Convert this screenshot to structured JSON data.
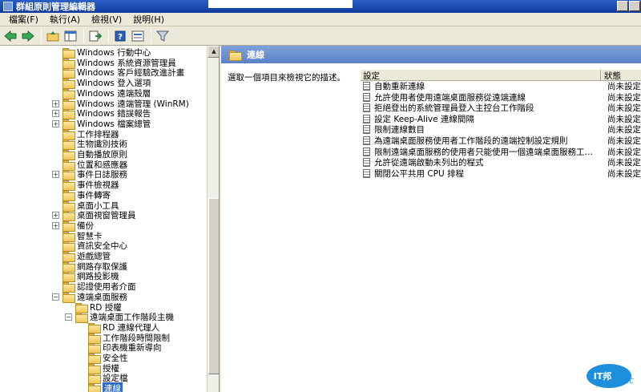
{
  "window": {
    "title": "群組原則管理編輯器"
  },
  "menu": [
    "檔案(F)",
    "執行(A)",
    "檢視(V)",
    "說明(H)"
  ],
  "toolbar": [
    "back-icon",
    "forward-icon",
    "up-folder-icon",
    "show-hide-tree-icon",
    "export-list-icon",
    "help-icon",
    "properties-icon",
    "filter-icon"
  ],
  "tree": [
    {
      "label": "Windows 行動中心",
      "indent": 0,
      "expandable": false
    },
    {
      "label": "Windows 系統資源管理員",
      "indent": 0,
      "expandable": false
    },
    {
      "label": "Windows 客戶經驗改進計畫",
      "indent": 0,
      "expandable": false
    },
    {
      "label": "Windows 登入選項",
      "indent": 0,
      "expandable": false
    },
    {
      "label": "Windows 遠端殼層",
      "indent": 0,
      "expandable": false
    },
    {
      "label": "Windows 遠端管理 (WinRM)",
      "indent": 0,
      "expandable": true
    },
    {
      "label": "Windows 錯誤報告",
      "indent": 0,
      "expandable": true
    },
    {
      "label": "Windows 檔案總管",
      "indent": 0,
      "expandable": true
    },
    {
      "label": "工作排程器",
      "indent": 0,
      "expandable": false
    },
    {
      "label": "生物識別技術",
      "indent": 0,
      "expandable": false
    },
    {
      "label": "自動播放原則",
      "indent": 0,
      "expandable": false
    },
    {
      "label": "位置和感應器",
      "indent": 0,
      "expandable": false
    },
    {
      "label": "事件日誌服務",
      "indent": 0,
      "expandable": true
    },
    {
      "label": "事件檢視器",
      "indent": 0,
      "expandable": false
    },
    {
      "label": "事件轉寄",
      "indent": 0,
      "expandable": false
    },
    {
      "label": "桌面小工具",
      "indent": 0,
      "expandable": false
    },
    {
      "label": "桌面視窗管理員",
      "indent": 0,
      "expandable": true
    },
    {
      "label": "備份",
      "indent": 0,
      "expandable": true
    },
    {
      "label": "智慧卡",
      "indent": 0,
      "expandable": false
    },
    {
      "label": "資訊安全中心",
      "indent": 0,
      "expandable": false
    },
    {
      "label": "遊戲總管",
      "indent": 0,
      "expandable": false
    },
    {
      "label": "網路存取保護",
      "indent": 0,
      "expandable": false
    },
    {
      "label": "網路投影機",
      "indent": 0,
      "expandable": false
    },
    {
      "label": "認證使用者介面",
      "indent": 0,
      "expandable": false
    },
    {
      "label": "遠端桌面服務",
      "indent": 0,
      "expandable": "open"
    },
    {
      "label": "RD 授權",
      "indent": 1,
      "expandable": false
    },
    {
      "label": "遠端桌面工作階段主機",
      "indent": 1,
      "expandable": "open"
    },
    {
      "label": "RD 連線代理人",
      "indent": 2,
      "expandable": false
    },
    {
      "label": "工作階段時間限制",
      "indent": 2,
      "expandable": false
    },
    {
      "label": "印表機重新導向",
      "indent": 2,
      "expandable": false
    },
    {
      "label": "安全性",
      "indent": 2,
      "expandable": false
    },
    {
      "label": "授權",
      "indent": 2,
      "expandable": false
    },
    {
      "label": "設定檔",
      "indent": 2,
      "expandable": false
    },
    {
      "label": "連線",
      "indent": 2,
      "expandable": false,
      "selected": true
    }
  ],
  "details": {
    "header": "連線",
    "description_prompt": "選取一個項目來檢視它的描述。",
    "columns": {
      "setting": "設定",
      "state": "狀態"
    },
    "rows": [
      {
        "name": "自動重新連線",
        "state": "尚未設定"
      },
      {
        "name": "允許使用者使用遠端桌面服務從遠端連線",
        "state": "尚未設定"
      },
      {
        "name": "拒絕登出的系統管理員登入主控台工作階段",
        "state": "尚未設定"
      },
      {
        "name": "設定 Keep-Alive 連線間隔",
        "state": "尚未設定"
      },
      {
        "name": "限制連線數目",
        "state": "尚未設定"
      },
      {
        "name": "為遠端桌面服務使用者工作階段的遠端控制設定規則",
        "state": "尚未設定"
      },
      {
        "name": "限制遠端桌面服務的使用者只能使用一個遠端桌面服務工作...",
        "state": "尚未設定"
      },
      {
        "name": "允許從遠端啟動未列出的程式",
        "state": "尚未設定"
      },
      {
        "name": "關閉公平共用 CPU 排程",
        "state": "尚未設定"
      }
    ]
  },
  "watermark": {
    "text1": "IT邦",
    "text2": "幫忙"
  }
}
